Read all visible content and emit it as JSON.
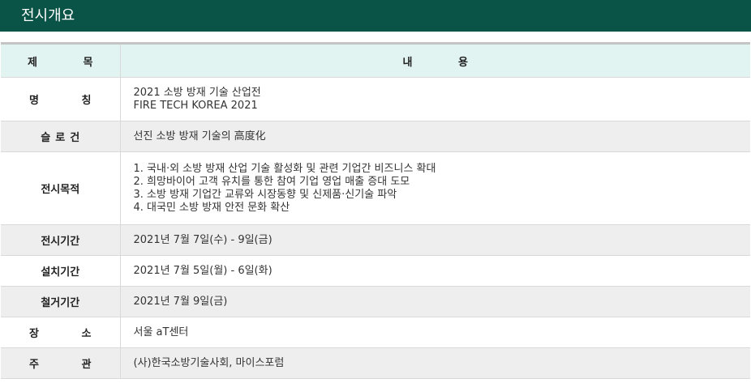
{
  "title": "전시개요",
  "table": {
    "header": {
      "label": "제 목",
      "content": "내 용"
    },
    "rows": [
      {
        "label": "명 칭",
        "lines": [
          "2021 소방 방재 기술 산업전",
          "FIRE TECH KOREA 2021"
        ]
      },
      {
        "label": "슬로건",
        "lines": [
          "선진 소방 방재 기술의 高度化"
        ]
      },
      {
        "label": "전시목적",
        "lines": [
          "1. 국내·외 소방 방재 산업 기술 활성화 및 관련 기업간 비즈니스 확대",
          "2. 희망바이어 고객 유치를 통한 참여 기업 영업 매출 증대 도모",
          "3. 소방 방재 기업간 교류와 시장동향 및 신제품·신기술 파악",
          "4. 대국민 소방 방재 안전 문화 확산"
        ]
      },
      {
        "label": "전시기간",
        "lines": [
          "2021년 7월 7일(수) - 9일(금)"
        ]
      },
      {
        "label": "설치기간",
        "lines": [
          "2021년 7월 5일(월) - 6일(화)"
        ]
      },
      {
        "label": "철거기간",
        "lines": [
          "2021년 7월 9일(금)"
        ]
      },
      {
        "label": "장 소",
        "lines": [
          "서울 aT센터"
        ]
      },
      {
        "label": "주 관",
        "lines": [
          "(사)한국소방기술사회, 마이스포럼"
        ]
      }
    ]
  },
  "colors": {
    "title_bar": "#0a5447",
    "header_row": "#e2f4f2",
    "shaded_row": "#eeeeee",
    "border": "#d9d9d9"
  }
}
